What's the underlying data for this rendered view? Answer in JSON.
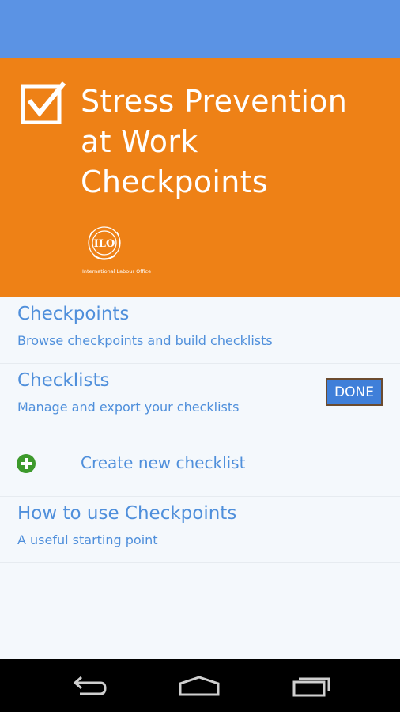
{
  "banner": {
    "title_lines": [
      "Stress Prevention",
      "at Work",
      "Checkpoints"
    ],
    "org_caption": "International Labour Office",
    "org_logo_text": "ILO"
  },
  "menu": {
    "checkpoints": {
      "title": "Checkpoints",
      "subtitle": "Browse checkpoints and build checklists"
    },
    "checklists": {
      "title": "Checklists",
      "subtitle": "Manage and export your checklists",
      "done_label": "DONE"
    },
    "create": {
      "label": "Create new checklist"
    },
    "howto": {
      "title": "How to use Checkpoints",
      "subtitle": "A useful starting point"
    }
  },
  "colors": {
    "status_bar": "#5b93e4",
    "banner": "#ee8116",
    "link_text": "#4f8fdb",
    "done_button": "#3f7fd9",
    "plus_icon": "#3d9a2c"
  },
  "icons": {
    "banner_logo": "checkbox-check-icon",
    "create": "plus-circle-icon",
    "nav_back": "back-arrow-icon",
    "nav_home": "home-icon",
    "nav_recents": "recents-icon"
  }
}
